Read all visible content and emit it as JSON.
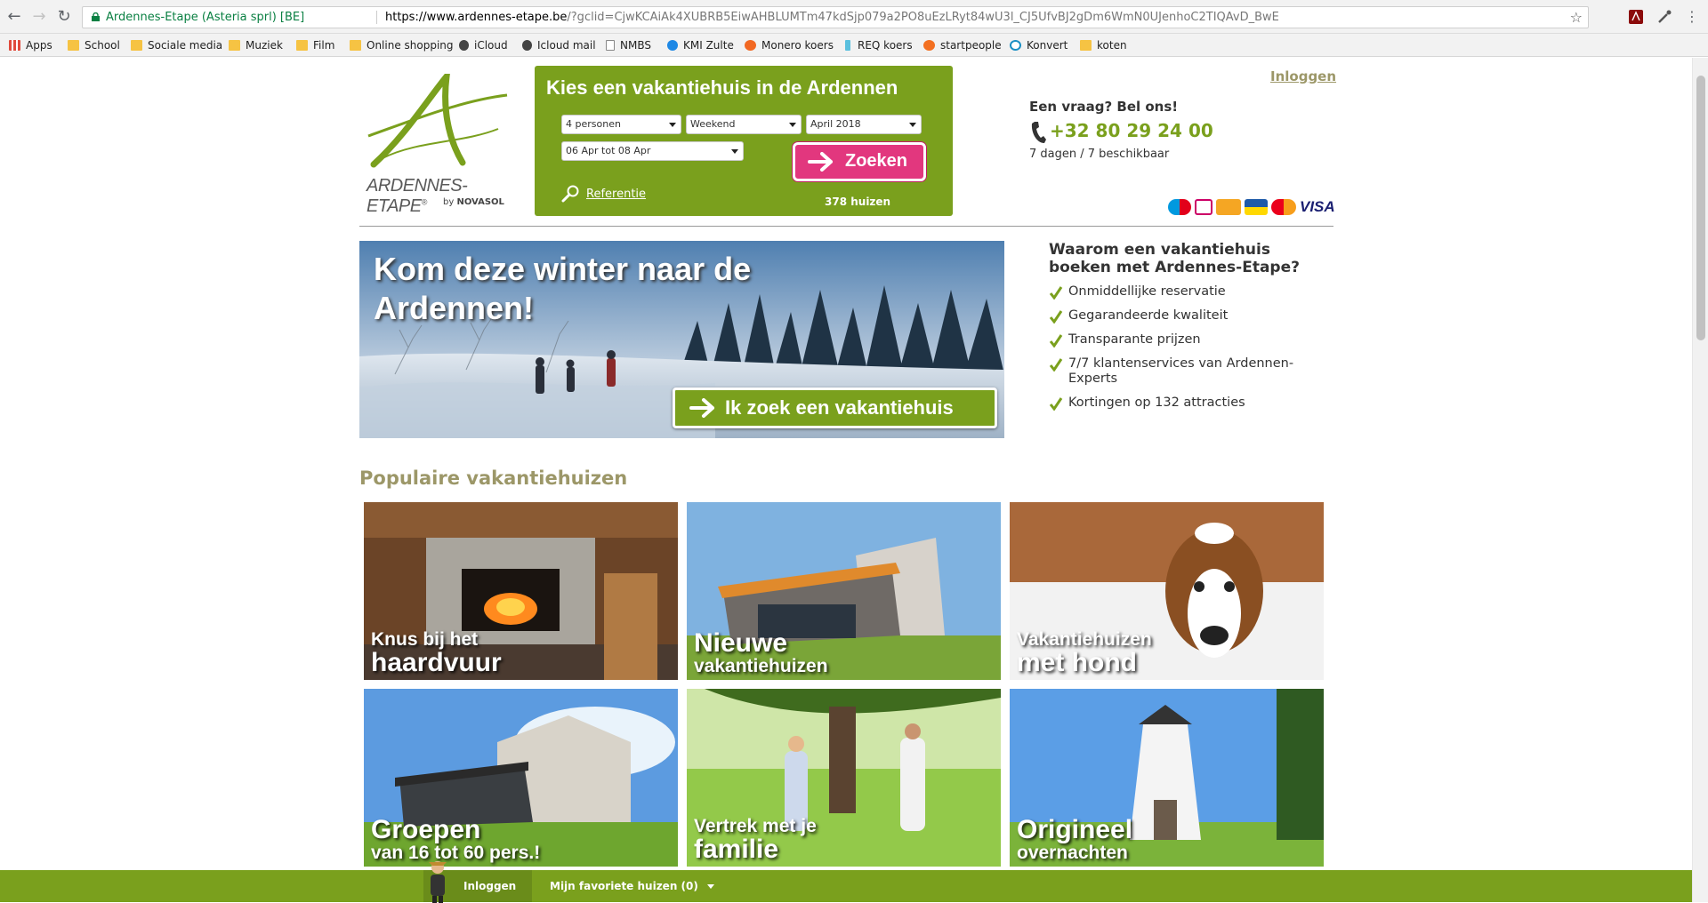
{
  "browser": {
    "site_label": "Ardennes-Etape (Asteria sprl) [BE]",
    "url_host": "https://www.ardennes-etape.be",
    "url_path": "/?gclid=CjwKCAiAk4XUBRB5EiwAHBLUMTm47kdSjp079a2PO8uEzLRyt84wU3l_CJ5UfvBJ2gDm6WmN0UJenhoC2TIQAvD_BwE",
    "bookmarks": [
      {
        "label": "Apps",
        "icon": "apps-grid"
      },
      {
        "label": "School",
        "icon": "folder"
      },
      {
        "label": "Sociale media",
        "icon": "folder"
      },
      {
        "label": "Muziek",
        "icon": "folder"
      },
      {
        "label": "Film",
        "icon": "folder"
      },
      {
        "label": "Online shopping",
        "icon": "folder"
      },
      {
        "label": "iCloud",
        "icon": "apple"
      },
      {
        "label": "Icloud mail",
        "icon": "apple"
      },
      {
        "label": "NMBS",
        "icon": "page"
      },
      {
        "label": "KMI Zulte",
        "icon": "kmi"
      },
      {
        "label": "Monero koers",
        "icon": "monero"
      },
      {
        "label": "REQ koers",
        "icon": "req"
      },
      {
        "label": "startpeople",
        "icon": "startpeople"
      },
      {
        "label": "Konvert",
        "icon": "konvert"
      },
      {
        "label": "koten",
        "icon": "folder"
      }
    ]
  },
  "header": {
    "logo_wordmark": "ARDENNES-ETAPE",
    "logo_reg": "®",
    "logo_by": "by",
    "logo_brand": "NOVASOL",
    "login": "Inloggen",
    "contact_question": "Een vraag? Bel ons!",
    "phone": "+32 80 29 24 00",
    "availability": "7 dagen / 7 beschikbaar",
    "payment_methods": [
      "Maestro",
      "iDEAL",
      "Sofort",
      "Bancontact",
      "MasterCard",
      "VISA"
    ]
  },
  "search": {
    "title": "Kies een vakantiehuis in de Ardennen",
    "persons": "4 personen",
    "duration": "Weekend",
    "month": "April 2018",
    "period": "06 Apr tot 08 Apr",
    "button": "Zoeken",
    "reference": "Referentie",
    "count": "378 huizen"
  },
  "hero": {
    "title": "Kom deze winter naar de Ardennen!",
    "button": "Ik zoek een vakantiehuis"
  },
  "why": {
    "title": "Waarom een vakantiehuis boeken met Ardennes-Etape?",
    "items": [
      "Onmiddellijke reservatie",
      "Gegarandeerde kwaliteit",
      "Transparante prijzen",
      "7/7 klantenservices van Ardennen-Experts",
      "Kortingen op 132 attracties"
    ]
  },
  "popular": {
    "title": "Populaire vakantiehuizen",
    "tiles": [
      {
        "line1": "Knus bij het",
        "line2": "haardvuur"
      },
      {
        "line1": "Nieuwe",
        "line2": "vakantiehuizen"
      },
      {
        "line1": "Vakantiehuizen",
        "line2": "met hond"
      },
      {
        "line1": "Groepen",
        "line2": "van 16 tot 60 pers.!"
      },
      {
        "line1": "Vertrek met je",
        "line2": "familie"
      },
      {
        "line1": "Origineel",
        "line2": "overnachten"
      }
    ]
  },
  "bottom_bar": {
    "login": "Inloggen",
    "favorites": "Mijn favoriete huizen (0)"
  },
  "colors": {
    "brand_green": "#7aa01d",
    "cta_pink": "#e2377e",
    "khaki": "#9c9768"
  }
}
